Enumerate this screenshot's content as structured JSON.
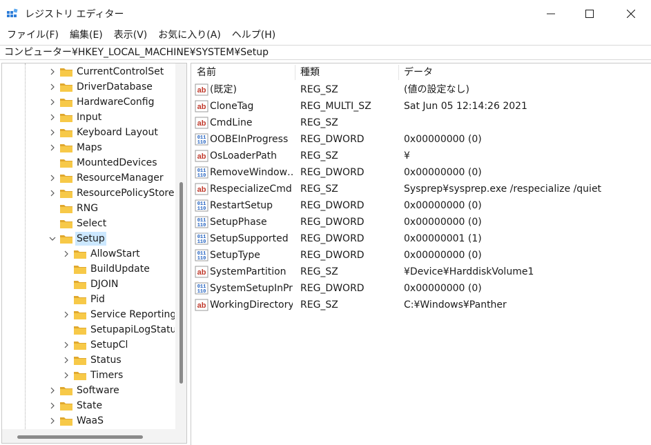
{
  "window": {
    "title": "レジストリ エディター",
    "controls": {
      "minimize": "minimize-icon",
      "maximize": "maximize-icon",
      "close": "close-icon"
    }
  },
  "menu": [
    "ファイル(F)",
    "編集(E)",
    "表示(V)",
    "お気に入り(A)",
    "ヘルプ(H)"
  ],
  "address": "コンピューター¥HKEY_LOCAL_MACHINE¥SYSTEM¥Setup",
  "tree": {
    "items": [
      {
        "label": "CurrentControlSet",
        "expandable": true
      },
      {
        "label": "DriverDatabase",
        "expandable": true
      },
      {
        "label": "HardwareConfig",
        "expandable": true
      },
      {
        "label": "Input",
        "expandable": true
      },
      {
        "label": "Keyboard Layout",
        "expandable": true
      },
      {
        "label": "Maps",
        "expandable": true
      },
      {
        "label": "MountedDevices",
        "expandable": false
      },
      {
        "label": "ResourceManager",
        "expandable": true
      },
      {
        "label": "ResourcePolicyStore",
        "expandable": true
      },
      {
        "label": "RNG",
        "expandable": false
      },
      {
        "label": "Select",
        "expandable": false
      },
      {
        "label": "Setup",
        "expandable": true,
        "expanded": true,
        "selected": true
      },
      {
        "label": "AllowStart",
        "expandable": true,
        "child": true
      },
      {
        "label": "BuildUpdate",
        "expandable": false,
        "child": true
      },
      {
        "label": "DJOIN",
        "expandable": false,
        "child": true
      },
      {
        "label": "Pid",
        "expandable": false,
        "child": true
      },
      {
        "label": "Service Reporting",
        "expandable": true,
        "child": true
      },
      {
        "label": "SetupapiLogStatu",
        "expandable": false,
        "child": true
      },
      {
        "label": "SetupCl",
        "expandable": true,
        "child": true
      },
      {
        "label": "Status",
        "expandable": true,
        "child": true
      },
      {
        "label": "Timers",
        "expandable": true,
        "child": true
      },
      {
        "label": "Software",
        "expandable": true
      },
      {
        "label": "State",
        "expandable": true
      },
      {
        "label": "WaaS",
        "expandable": true
      }
    ]
  },
  "values": {
    "columns": {
      "name": "名前",
      "type": "種類",
      "data": "データ"
    },
    "rows": [
      {
        "icon": "string-value-icon",
        "name": "(既定)",
        "type": "REG_SZ",
        "data": "(値の設定なし)"
      },
      {
        "icon": "string-value-icon",
        "name": "CloneTag",
        "type": "REG_MULTI_SZ",
        "data": "Sat Jun 05 12:14:26 2021"
      },
      {
        "icon": "string-value-icon",
        "name": "CmdLine",
        "type": "REG_SZ",
        "data": ""
      },
      {
        "icon": "binary-value-icon",
        "name": "OOBEInProgress",
        "type": "REG_DWORD",
        "data": "0x00000000 (0)"
      },
      {
        "icon": "string-value-icon",
        "name": "OsLoaderPath",
        "type": "REG_SZ",
        "data": "¥"
      },
      {
        "icon": "binary-value-icon",
        "name": "RemoveWindow…",
        "type": "REG_DWORD",
        "data": "0x00000000 (0)"
      },
      {
        "icon": "string-value-icon",
        "name": "RespecializeCmd…",
        "type": "REG_SZ",
        "data": "Sysprep¥sysprep.exe /respecialize /quiet"
      },
      {
        "icon": "binary-value-icon",
        "name": "RestartSetup",
        "type": "REG_DWORD",
        "data": "0x00000000 (0)"
      },
      {
        "icon": "binary-value-icon",
        "name": "SetupPhase",
        "type": "REG_DWORD",
        "data": "0x00000000 (0)"
      },
      {
        "icon": "binary-value-icon",
        "name": "SetupSupported",
        "type": "REG_DWORD",
        "data": "0x00000001 (1)"
      },
      {
        "icon": "binary-value-icon",
        "name": "SetupType",
        "type": "REG_DWORD",
        "data": "0x00000000 (0)"
      },
      {
        "icon": "string-value-icon",
        "name": "SystemPartition",
        "type": "REG_SZ",
        "data": "¥Device¥HarddiskVolume1"
      },
      {
        "icon": "binary-value-icon",
        "name": "SystemSetupInPr…",
        "type": "REG_DWORD",
        "data": "0x00000000 (0)"
      },
      {
        "icon": "string-value-icon",
        "name": "WorkingDirectory",
        "type": "REG_SZ",
        "data": "C:¥Windows¥Panther"
      }
    ]
  },
  "colors": {
    "selection": "#cce8ff",
    "folder": "#f7c948",
    "folder_dark": "#e0a82e",
    "string_icon": "#c0392b",
    "binary_icon": "#1f5fbf"
  }
}
